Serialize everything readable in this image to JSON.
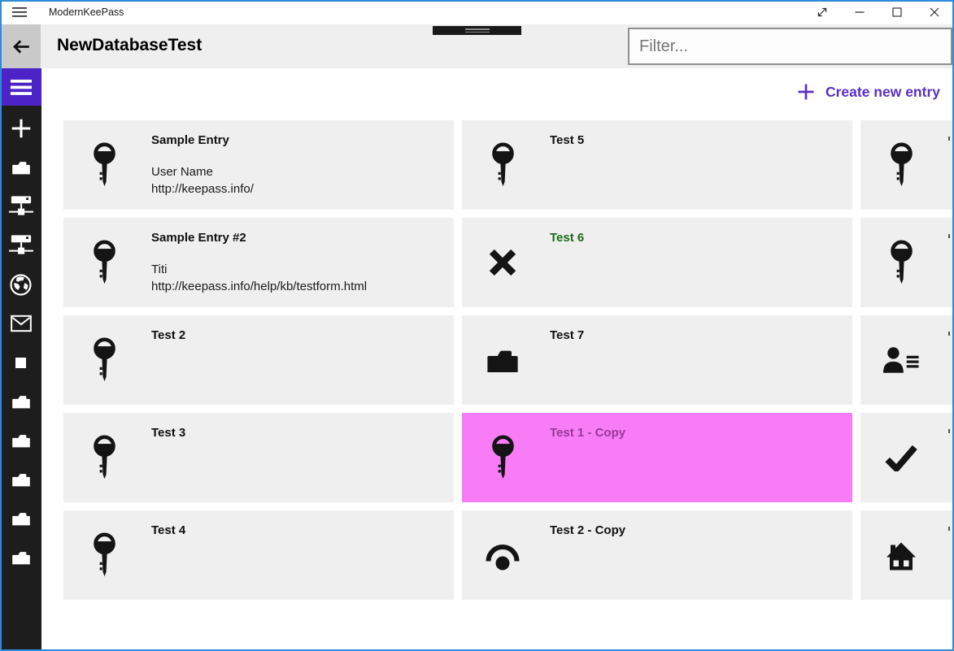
{
  "titlebar": {
    "app_title": "ModernKeePass",
    "controls": [
      {
        "name": "enter-fullscreen"
      },
      {
        "name": "minimize"
      },
      {
        "name": "maximize"
      },
      {
        "name": "close"
      }
    ]
  },
  "header": {
    "db_title": "NewDatabaseTest",
    "filter_placeholder": "Filter..."
  },
  "toolbar": {
    "create_entry_label": "Create new entry"
  },
  "sidebar": {
    "items": [
      {
        "icon": "hamburger-icon"
      },
      {
        "icon": "plus-icon"
      },
      {
        "icon": "folder-icon"
      },
      {
        "icon": "network-icon"
      },
      {
        "icon": "network-icon"
      },
      {
        "icon": "globe-icon"
      },
      {
        "icon": "mail-icon"
      },
      {
        "icon": "square-icon"
      },
      {
        "icon": "folder-icon"
      },
      {
        "icon": "folder-icon"
      },
      {
        "icon": "folder-icon"
      },
      {
        "icon": "folder-icon"
      },
      {
        "icon": "folder-icon"
      }
    ]
  },
  "entries": [
    {
      "icon": "key",
      "title": "Sample Entry",
      "details": [
        "User Name",
        "http://keepass.info/"
      ]
    },
    {
      "icon": "key",
      "title": "Test 5"
    },
    {
      "icon": "key",
      "title": "",
      "clipped": true
    },
    {
      "icon": "key",
      "title": "Sample Entry #2",
      "details": [
        "Titi",
        "http://keepass.info/help/kb/testform.html"
      ]
    },
    {
      "icon": "x",
      "title": "Test 6",
      "title_color": "#186a18"
    },
    {
      "icon": "key",
      "title": "",
      "clipped": true
    },
    {
      "icon": "key",
      "title": "Test 2"
    },
    {
      "icon": "folder",
      "title": "Test 7"
    },
    {
      "icon": "contact",
      "title": "",
      "clipped": true
    },
    {
      "icon": "key",
      "title": "Test 3"
    },
    {
      "icon": "key",
      "title": "Test 1 - Copy",
      "selected": true,
      "title_color": "#953a99"
    },
    {
      "icon": "check",
      "title": "",
      "clipped": true
    },
    {
      "icon": "key",
      "title": "Test 4"
    },
    {
      "icon": "eye",
      "title": "Test 2 - Copy"
    },
    {
      "icon": "home",
      "title": "",
      "clipped": true
    }
  ],
  "colors": {
    "accent_purple": "#5a2ec6",
    "sidebar_hamburger_bg": "#4c23c6",
    "sidebar_bg": "#1d1d1d",
    "header_bg": "#efefef",
    "card_bg": "#efefef",
    "selected_card_bg": "#f97cf7",
    "selected_title": "#953a99",
    "green_title": "#186a18",
    "window_border": "#2e8bd9",
    "back_button_bg": "#c9c9c9"
  }
}
